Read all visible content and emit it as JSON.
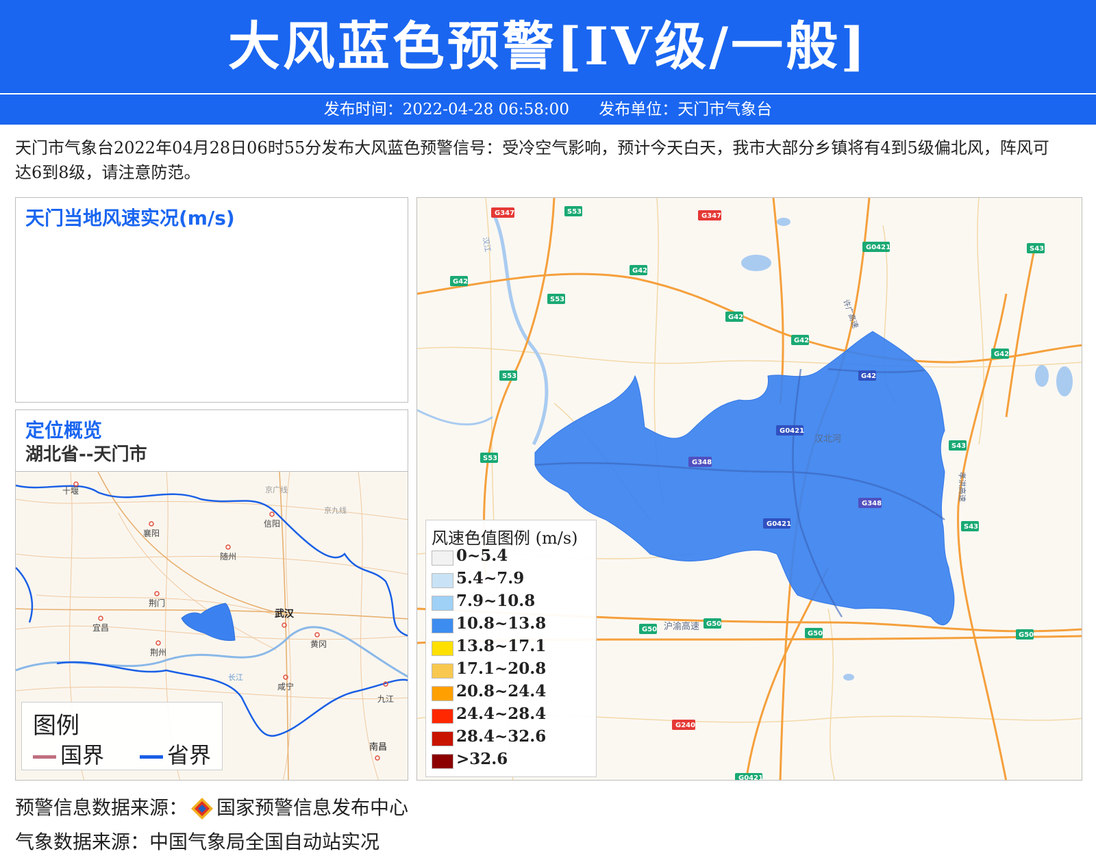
{
  "header": {
    "title": "大风蓝色预警[IV级/一般]",
    "publish_time": "发布时间：2022-04-28 06:58:00",
    "publish_unit": "发布单位：天门市气象台"
  },
  "description": "天门市气象台2022年04月28日06时55分发布大风蓝色预警信号：受冷空气影响，预计今天白天，我市大部分乡镇将有4到5级偏北风，阵风可达6到8级，请注意防范。",
  "wind_panel": {
    "title": "天门当地风速实况(m/s)"
  },
  "location_panel": {
    "title": "定位概览",
    "subtitle": "湖北省--天门市"
  },
  "overview_map": {
    "cities": [
      "十堰",
      "襄阳",
      "信阳",
      "随州",
      "荆门",
      "宜昌",
      "荆州",
      "武汉",
      "黄冈",
      "咸宁",
      "九江",
      "南昌"
    ],
    "road_labels": [
      "京广线",
      "京九线",
      "长江"
    ],
    "legend": {
      "title": "图例",
      "items": [
        {
          "label": "国界",
          "color": "#c07080"
        },
        {
          "label": "省界",
          "color": "#1a5fe6"
        }
      ]
    }
  },
  "main_map": {
    "highlight_color": "#3b82f0",
    "road_shields": [
      {
        "label": "G347",
        "color": "#e53935"
      },
      {
        "label": "S53",
        "color": "#1aa974"
      },
      {
        "label": "G347",
        "color": "#e53935"
      },
      {
        "label": "G0421",
        "color": "#1aa974"
      },
      {
        "label": "S43",
        "color": "#1aa974"
      },
      {
        "label": "G42",
        "color": "#1aa974"
      },
      {
        "label": "G42",
        "color": "#1aa974"
      },
      {
        "label": "S53",
        "color": "#1aa974"
      },
      {
        "label": "G42",
        "color": "#1aa974"
      },
      {
        "label": "G42",
        "color": "#1aa974"
      },
      {
        "label": "G42",
        "color": "#1aa974"
      },
      {
        "label": "S53",
        "color": "#1aa974"
      },
      {
        "label": "G42",
        "color": "#3050c0"
      },
      {
        "label": "G0421",
        "color": "#3050c0"
      },
      {
        "label": "S53",
        "color": "#1aa974"
      },
      {
        "label": "G348",
        "color": "#5050c0"
      },
      {
        "label": "S43",
        "color": "#1aa974"
      },
      {
        "label": "G348",
        "color": "#5050c0"
      },
      {
        "label": "G0421",
        "color": "#3050c0"
      },
      {
        "label": "S43",
        "color": "#1aa974"
      },
      {
        "label": "G50",
        "color": "#1aa974"
      },
      {
        "label": "G50",
        "color": "#1aa974"
      },
      {
        "label": "G50",
        "color": "#1aa974"
      },
      {
        "label": "G50",
        "color": "#1aa974"
      },
      {
        "label": "G240",
        "color": "#e53935"
      },
      {
        "label": "G0421",
        "color": "#1aa974"
      }
    ],
    "place_labels": [
      "汉北河",
      "沪渝高速",
      "孝洪高速",
      "汉江",
      "许广高速"
    ],
    "legend": {
      "title": "风速色值图例 (m/s)",
      "items": [
        {
          "label": "0~5.4",
          "color": "#f2f2f2"
        },
        {
          "label": "5.4~7.9",
          "color": "#c9e2f5"
        },
        {
          "label": "7.9~10.8",
          "color": "#9fd0f5"
        },
        {
          "label": "10.8~13.8",
          "color": "#3d8cf0"
        },
        {
          "label": "13.8~17.1",
          "color": "#ffe000"
        },
        {
          "label": "17.1~20.8",
          "color": "#f8c850"
        },
        {
          "label": "20.8~24.4",
          "color": "#ffa000"
        },
        {
          "label": "24.4~28.4",
          "color": "#ff2800"
        },
        {
          "label": "28.4~32.6",
          "color": "#c81400"
        },
        {
          "label": ">32.6",
          "color": "#8c0000"
        }
      ]
    }
  },
  "footer": {
    "warning_source": "预警信息数据来源：",
    "warning_org": "国家预警信息发布中心",
    "weather_source": "气象数据来源：中国气象局全国自动站实况"
  }
}
